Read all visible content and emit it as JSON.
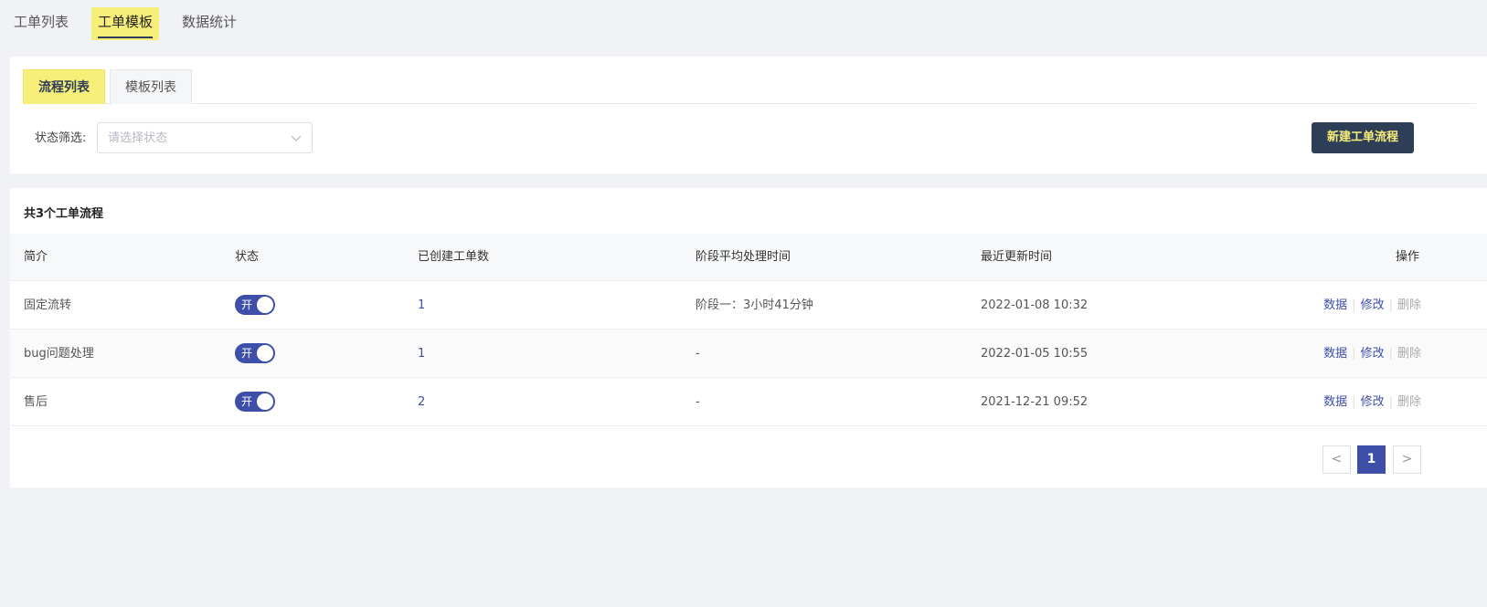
{
  "top_tabs": [
    {
      "label": "工单列表",
      "active": false
    },
    {
      "label": "工单模板",
      "active": true
    },
    {
      "label": "数据统计",
      "active": false
    }
  ],
  "sub_tabs": [
    {
      "label": "流程列表",
      "active": true
    },
    {
      "label": "模板列表",
      "active": false
    }
  ],
  "filter": {
    "label": "状态筛选:",
    "placeholder": "请选择状态"
  },
  "new_button": "新建工单流程",
  "table": {
    "count_title": "共3个工单流程",
    "headers": [
      "简介",
      "状态",
      "已创建工单数",
      "阶段平均处理时间",
      "最近更新时间",
      "操作"
    ],
    "rows": [
      {
        "name": "固定流转",
        "status": "开",
        "count": "1",
        "avg_time": "阶段一：3小时41分钟",
        "updated": "2022-01-08 10:32"
      },
      {
        "name": "bug问题处理",
        "status": "开",
        "count": "1",
        "avg_time": "-",
        "updated": "2022-01-05 10:55"
      },
      {
        "name": "售后",
        "status": "开",
        "count": "2",
        "avg_time": "-",
        "updated": "2021-12-21 09:52"
      }
    ],
    "actions": {
      "data": "数据",
      "edit": "修改",
      "delete": "删除"
    }
  },
  "pagination": {
    "prev": "<",
    "current": "1",
    "next": ">"
  },
  "colors": {
    "accent": "#3d4fa8",
    "highlight": "#f7ef7a",
    "dark": "#2f3e57"
  }
}
